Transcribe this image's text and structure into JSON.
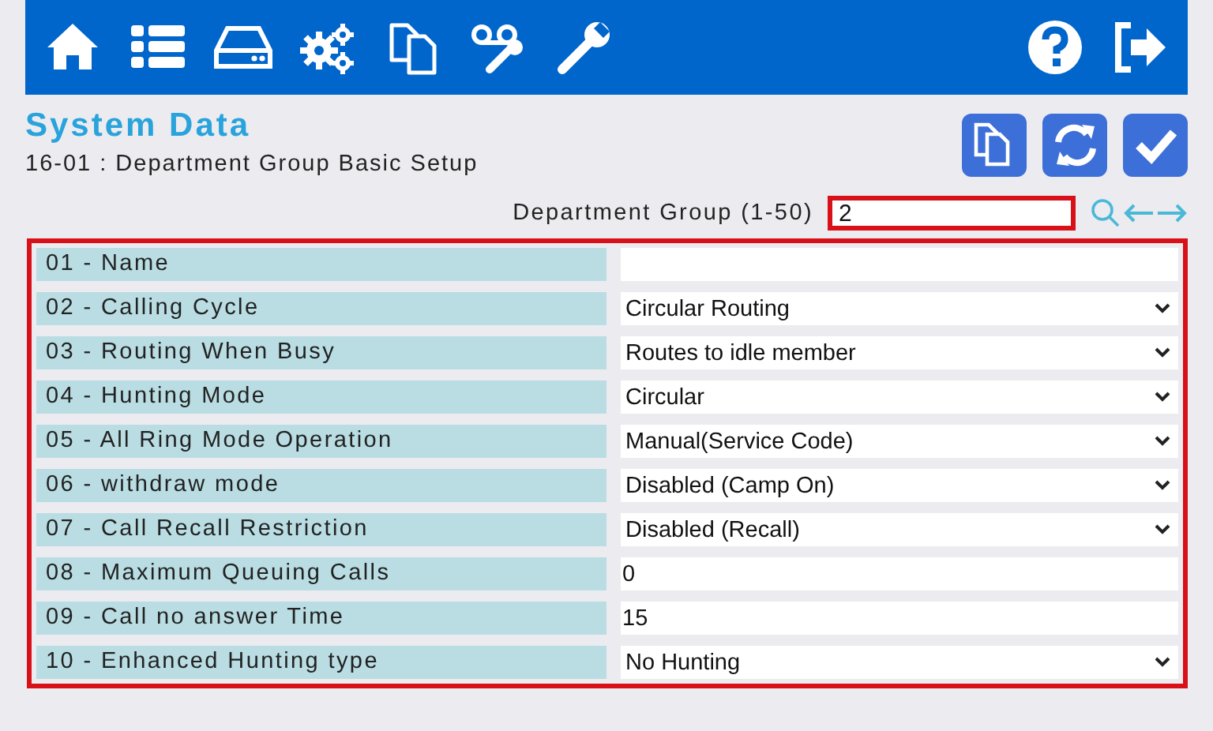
{
  "header": {
    "title": "System Data",
    "subtitle": "16-01 : Department Group Basic Setup"
  },
  "selector": {
    "label": "Department Group (1-50)",
    "value": "2"
  },
  "rows": [
    {
      "label": "01 - Name",
      "kind": "text"
    },
    {
      "label": "02 - Calling Cycle",
      "kind": "select",
      "value": "Circular Routing"
    },
    {
      "label": "03 - Routing When Busy",
      "kind": "select",
      "value": "Routes to idle member"
    },
    {
      "label": "04 - Hunting Mode",
      "kind": "select",
      "value": "Circular"
    },
    {
      "label": "05 - All Ring Mode Operation",
      "kind": "select",
      "value": "Manual(Service Code)"
    },
    {
      "label": "06 - withdraw mode",
      "kind": "select",
      "value": "Disabled (Camp On)"
    },
    {
      "label": "07 - Call Recall Restriction",
      "kind": "select",
      "value": "Disabled (Recall)"
    },
    {
      "label": "08 - Maximum Queuing Calls",
      "kind": "text",
      "value": "0"
    },
    {
      "label": "09 - Call no answer Time",
      "kind": "text",
      "value": "15"
    },
    {
      "label": "10 - Enhanced Hunting type",
      "kind": "select",
      "value": "No Hunting"
    }
  ]
}
